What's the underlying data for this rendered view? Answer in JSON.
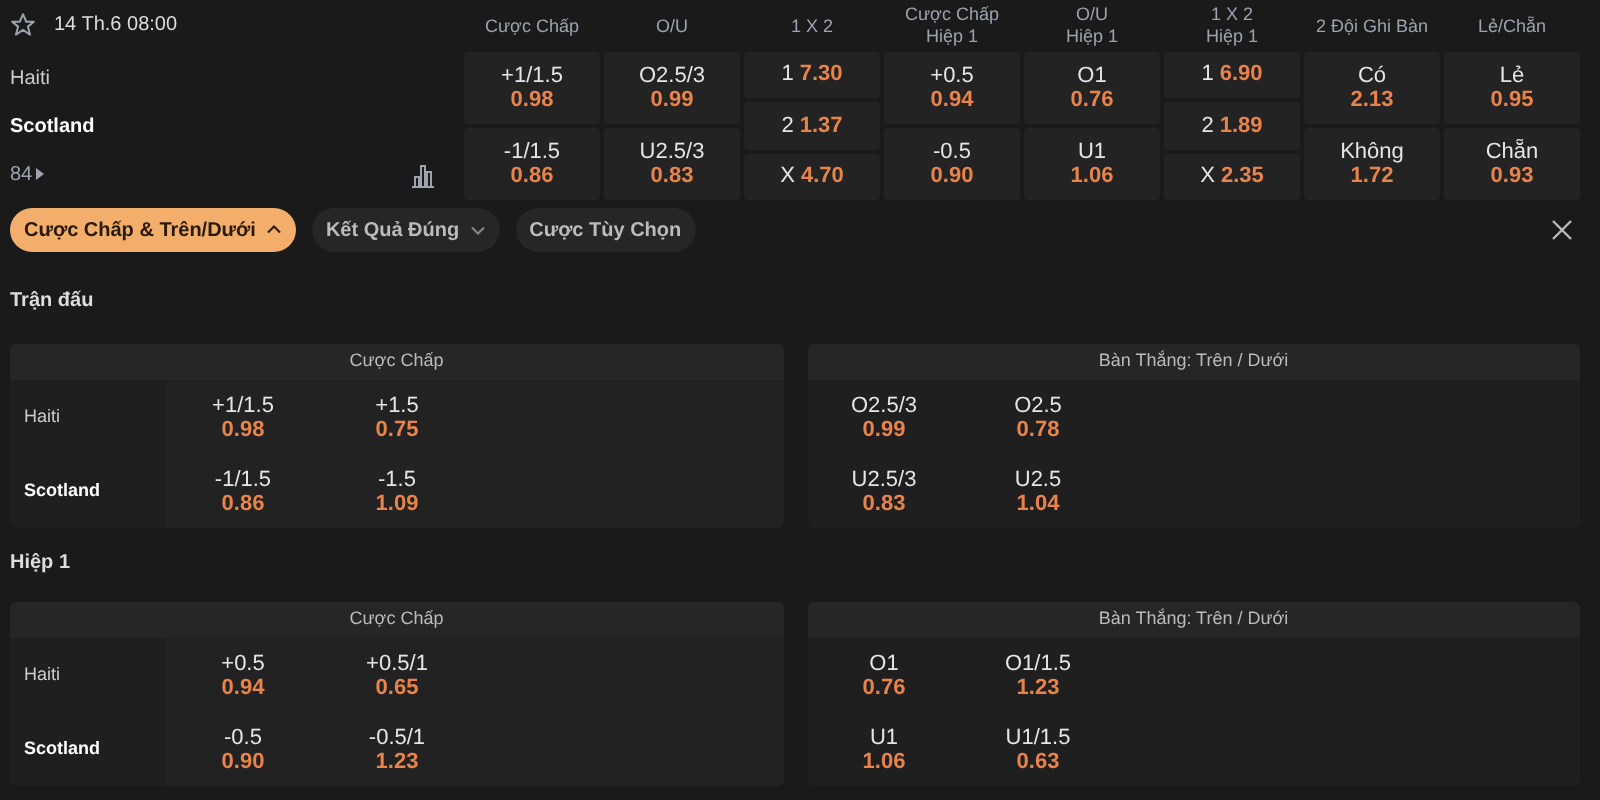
{
  "match": {
    "date": "14 Th.6 08:00",
    "teams": [
      {
        "name": "Haiti",
        "highlighted": false
      },
      {
        "name": "Scotland",
        "highlighted": true
      }
    ],
    "more_count": "84"
  },
  "columns": [
    {
      "header": [
        "Cược Chấp"
      ],
      "kind": "two",
      "cells": [
        {
          "line": "+1/1.5",
          "odds": "0.98"
        },
        {
          "line": "-1/1.5",
          "odds": "0.86"
        }
      ]
    },
    {
      "header": [
        "O/U"
      ],
      "kind": "two",
      "cells": [
        {
          "line": "O2.5/3",
          "odds": "0.99"
        },
        {
          "line": "U2.5/3",
          "odds": "0.83"
        }
      ]
    },
    {
      "header": [
        "1 X 2"
      ],
      "kind": "three",
      "cells": [
        {
          "line": "1",
          "odds": "7.30"
        },
        {
          "line": "2",
          "odds": "1.37"
        },
        {
          "line": "X",
          "odds": "4.70"
        }
      ]
    },
    {
      "header": [
        "Cược Chấp",
        "Hiệp 1"
      ],
      "kind": "two",
      "cells": [
        {
          "line": "+0.5",
          "odds": "0.94"
        },
        {
          "line": "-0.5",
          "odds": "0.90"
        }
      ]
    },
    {
      "header": [
        "O/U",
        "Hiệp 1"
      ],
      "kind": "two",
      "cells": [
        {
          "line": "O1",
          "odds": "0.76"
        },
        {
          "line": "U1",
          "odds": "1.06"
        }
      ]
    },
    {
      "header": [
        "1 X 2",
        "Hiệp 1"
      ],
      "kind": "three",
      "cells": [
        {
          "line": "1",
          "odds": "6.90"
        },
        {
          "line": "2",
          "odds": "1.89"
        },
        {
          "line": "X",
          "odds": "2.35"
        }
      ]
    },
    {
      "header": [
        "2 Đội Ghi Bàn"
      ],
      "kind": "two",
      "cells": [
        {
          "line": "Có",
          "odds": "2.13"
        },
        {
          "line": "Không",
          "odds": "1.72"
        }
      ]
    },
    {
      "header": [
        "Lẻ/Chẵn"
      ],
      "kind": "two",
      "cells": [
        {
          "line": "Lẻ",
          "odds": "0.95"
        },
        {
          "line": "Chẵn",
          "odds": "0.93"
        }
      ]
    }
  ],
  "filters": [
    {
      "label": "Cược Chấp & Trên/Dưới",
      "selected": true,
      "dropdown": true,
      "expanded": true
    },
    {
      "label": "Kết Quả Đúng",
      "selected": false,
      "dropdown": true,
      "expanded": false
    },
    {
      "label": "Cược Tùy Chọn",
      "selected": false,
      "dropdown": false
    }
  ],
  "sections": [
    {
      "title": "Trận đấu",
      "panels": [
        {
          "title": "Cược Chấp",
          "rows": [
            {
              "team": "Haiti",
              "highlighted": false,
              "cells": [
                {
                  "line": "+1/1.5",
                  "odds": "0.98"
                },
                {
                  "line": "+1.5",
                  "odds": "0.75"
                }
              ]
            },
            {
              "team": "Scotland",
              "highlighted": true,
              "cells": [
                {
                  "line": "-1/1.5",
                  "odds": "0.86"
                },
                {
                  "line": "-1.5",
                  "odds": "1.09"
                }
              ]
            }
          ]
        },
        {
          "title": "Bàn Thắng: Trên / Dưới",
          "rows": [
            {
              "cells": [
                {
                  "line": "O2.5/3",
                  "odds": "0.99"
                },
                {
                  "line": "O2.5",
                  "odds": "0.78"
                }
              ]
            },
            {
              "cells": [
                {
                  "line": "U2.5/3",
                  "odds": "0.83"
                },
                {
                  "line": "U2.5",
                  "odds": "1.04"
                }
              ]
            }
          ]
        }
      ]
    },
    {
      "title": "Hiệp 1",
      "panels": [
        {
          "title": "Cược Chấp",
          "rows": [
            {
              "team": "Haiti",
              "highlighted": false,
              "cells": [
                {
                  "line": "+0.5",
                  "odds": "0.94"
                },
                {
                  "line": "+0.5/1",
                  "odds": "0.65"
                }
              ]
            },
            {
              "team": "Scotland",
              "highlighted": true,
              "cells": [
                {
                  "line": "-0.5",
                  "odds": "0.90"
                },
                {
                  "line": "-0.5/1",
                  "odds": "1.23"
                }
              ]
            }
          ]
        },
        {
          "title": "Bàn Thắng: Trên / Dưới",
          "rows": [
            {
              "cells": [
                {
                  "line": "O1",
                  "odds": "0.76"
                },
                {
                  "line": "O1/1.5",
                  "odds": "1.23"
                }
              ]
            },
            {
              "cells": [
                {
                  "line": "U1",
                  "odds": "1.06"
                },
                {
                  "line": "U1/1.5",
                  "odds": "0.63"
                }
              ]
            }
          ]
        }
      ]
    }
  ]
}
